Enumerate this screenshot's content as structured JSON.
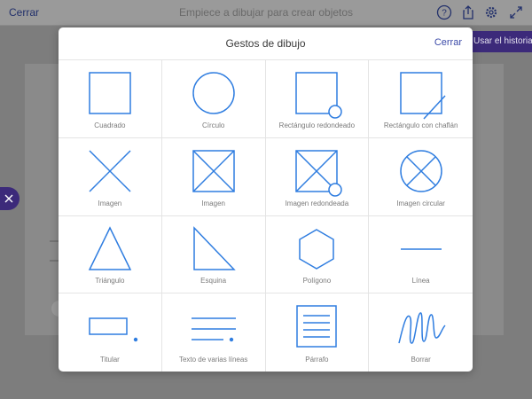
{
  "app": {
    "close_label": "Cerrar",
    "title": "Empiece a dibujar para crear objetos",
    "history_button": "Usar el historial",
    "icons": [
      "help-icon",
      "share-icon",
      "gear-icon",
      "expand-icon"
    ]
  },
  "colors": {
    "accent": "#2f7de0",
    "brand_purple": "#3c2a7a",
    "link": "#3b4aa8"
  },
  "modal": {
    "title": "Gestos de dibujo",
    "close_label": "Cerrar",
    "gestures": [
      {
        "label": "Cuadrado",
        "icon": "square-icon"
      },
      {
        "label": "Círculo",
        "icon": "circle-icon"
      },
      {
        "label": "Rectángulo redondeado",
        "icon": "rounded-rectangle-icon"
      },
      {
        "label": "Rectángulo con chaflán",
        "icon": "chamfered-rectangle-icon"
      },
      {
        "label": "Imagen",
        "icon": "cross-icon"
      },
      {
        "label": "Imagen",
        "icon": "image-box-icon"
      },
      {
        "label": "Imagen redondeada",
        "icon": "rounded-image-icon"
      },
      {
        "label": "Imagen circular",
        "icon": "circular-image-icon"
      },
      {
        "label": "Triángulo",
        "icon": "triangle-icon"
      },
      {
        "label": "Esquina",
        "icon": "corner-icon"
      },
      {
        "label": "Polígono",
        "icon": "hexagon-icon"
      },
      {
        "label": "Línea",
        "icon": "line-icon"
      },
      {
        "label": "Titular",
        "icon": "headline-icon"
      },
      {
        "label": "Texto de varias líneas",
        "icon": "multiline-text-icon"
      },
      {
        "label": "Párrafo",
        "icon": "paragraph-icon"
      },
      {
        "label": "Borrar",
        "icon": "scribble-icon"
      }
    ]
  }
}
